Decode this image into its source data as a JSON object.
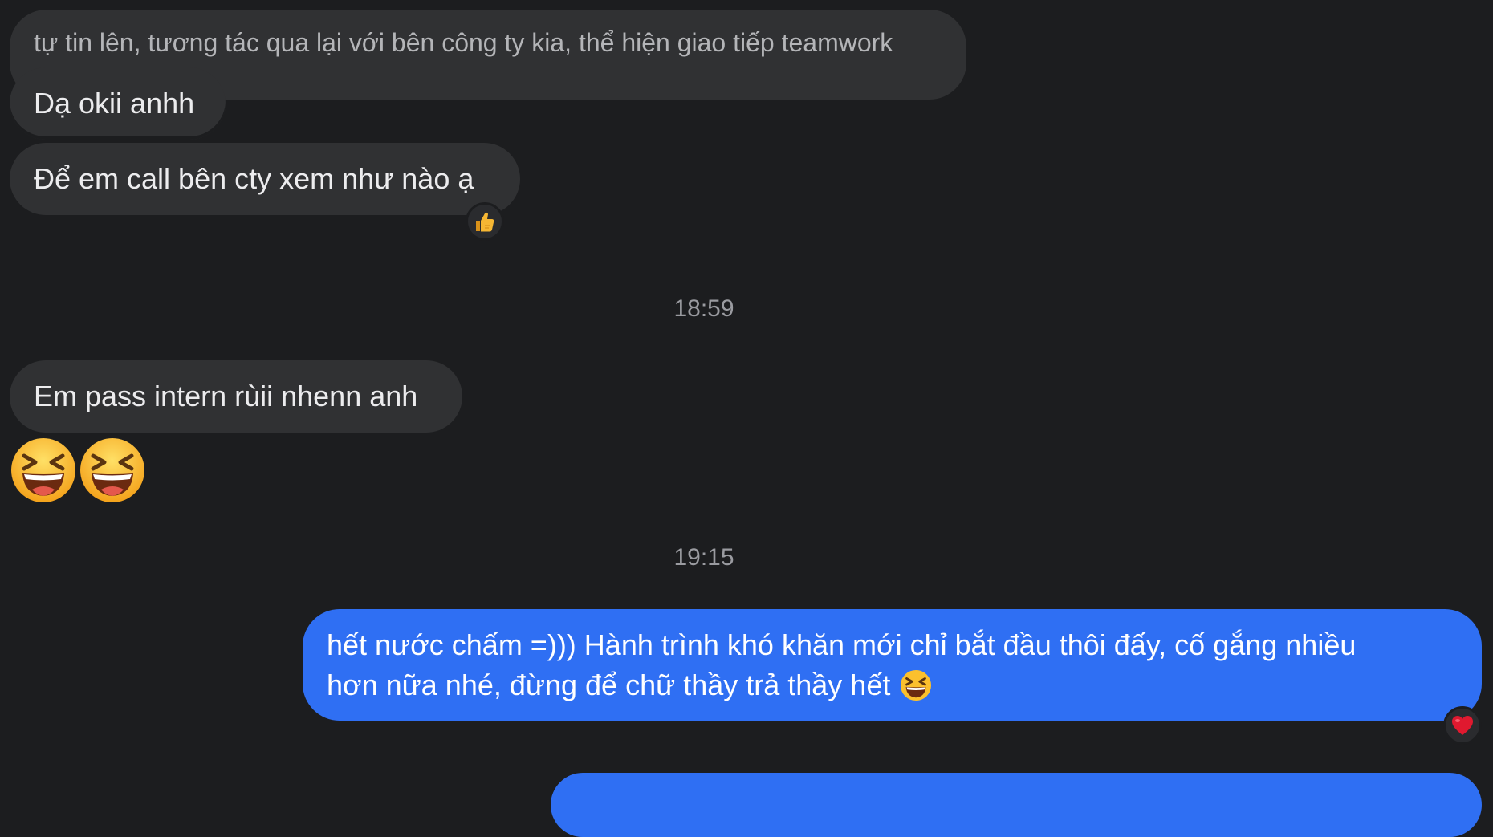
{
  "messages": {
    "m1": {
      "text": "tự tin lên, tương tác qua lại với bên công ty kia, thể hiện giao tiếp teamwork"
    },
    "m2": {
      "text": "Dạ okii anhh"
    },
    "m3": {
      "text": "Để em call bên cty xem như nào ạ",
      "reaction": "thumbs-up-icon"
    },
    "t1": "18:59",
    "m4": {
      "text": "Em pass intern rùii nhenn anh"
    },
    "m5": {
      "emoji": [
        "laughing-face-icon",
        "laughing-face-icon"
      ]
    },
    "t2": "19:15",
    "m6": {
      "line1": "hết nước chấm =))) Hành trình khó khăn mới chỉ bắt đầu thôi đấy, cố gắng nhiều",
      "line2": "hơn nữa nhé, đừng để chữ thầy trả thầy hết",
      "reaction": "heart-icon"
    }
  },
  "colors": {
    "background": "#1c1d1f",
    "incoming_bubble": "#303133",
    "outgoing_bubble": "#2f6ff3"
  }
}
